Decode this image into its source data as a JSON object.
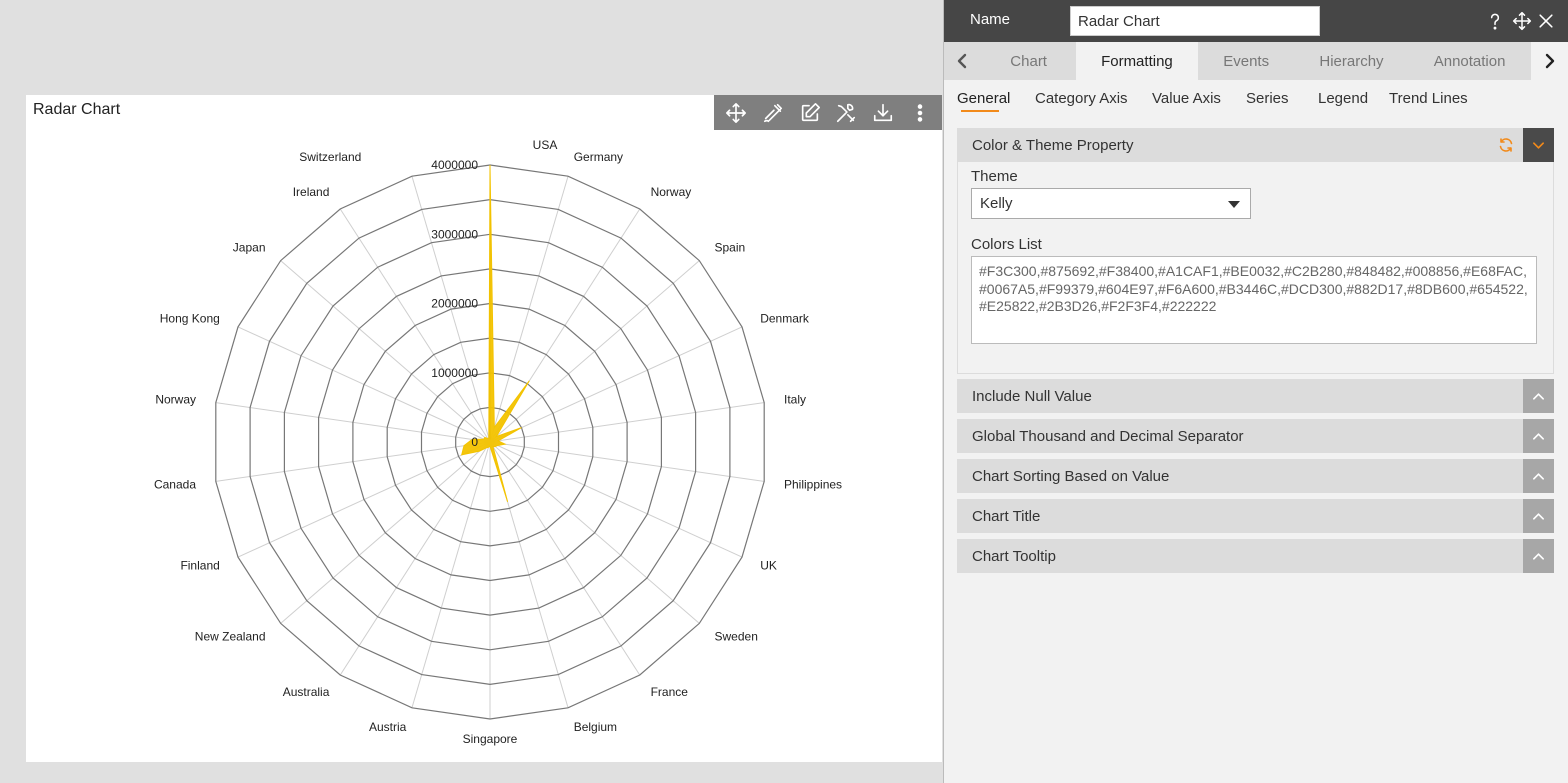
{
  "chart_card": {
    "title": "Radar Chart",
    "toolbar": [
      "move-icon",
      "ruler-pen-icon",
      "edit-icon",
      "tools-icon",
      "download-icon",
      "more-vertical-icon"
    ]
  },
  "chart_data": {
    "type": "radar",
    "title": "Radar Chart",
    "categories": [
      "USA",
      "Germany",
      "Norway",
      "Spain",
      "Denmark",
      "Italy",
      "Philippines",
      "UK",
      "Sweden",
      "France",
      "Belgium",
      "Singapore",
      "Austria",
      "Australia",
      "New Zealand",
      "Finland",
      "Canada",
      "Norway",
      "Hong Kong",
      "Japan",
      "Ireland",
      "Switzerland"
    ],
    "value_axis": {
      "min": 0,
      "max": 4000000,
      "ticks": [
        0,
        1000000,
        2000000,
        3000000,
        4000000
      ],
      "tick_labels": [
        "0",
        "1000000",
        "2000000",
        "3000000",
        "4000000"
      ]
    },
    "series": [
      {
        "color": "#F3C300",
        "values": [
          4000000,
          220000,
          1050000,
          120000,
          500000,
          120000,
          220000,
          120000,
          100000,
          80000,
          900000,
          60000,
          80000,
          100000,
          200000,
          450000,
          380000,
          260000,
          100000,
          100000,
          60000,
          60000
        ]
      }
    ]
  },
  "panel": {
    "name_label": "Name",
    "name_value": "Radar Chart",
    "header_icons": [
      "help-icon",
      "move-icon",
      "close-icon"
    ],
    "tabs": [
      "Chart",
      "Formatting",
      "Events",
      "Hierarchy",
      "Annotation"
    ],
    "active_tab": "Formatting",
    "subtabs": [
      "General",
      "Category Axis",
      "Value Axis",
      "Series",
      "Legend",
      "Trend Lines"
    ],
    "active_subtab": "General",
    "color_section": {
      "title": "Color & Theme Property",
      "theme_label": "Theme",
      "theme_value": "Kelly",
      "colors_label": "Colors List",
      "colors_value": "#F3C300,#875692,#F38400,#A1CAF1,#BE0032,#C2B280,#848482,#008856,#E68FAC,#0067A5,#F99379,#604E97,#F6A600,#B3446C,#DCD300,#882D17,#8DB600,#654522,#E25822,#2B3D26,#F2F3F4,#222222"
    },
    "collapsed_sections": [
      "Include Null Value",
      "Global Thousand and Decimal Separator",
      "Chart Sorting Based on Value",
      "Chart Title",
      "Chart Tooltip"
    ]
  }
}
